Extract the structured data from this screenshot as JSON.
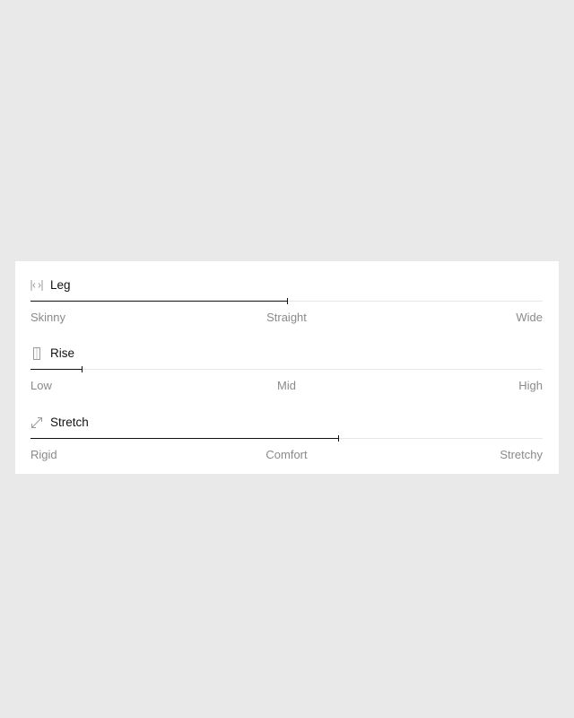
{
  "attributes": [
    {
      "title": "Leg",
      "icon": "leg-width-icon",
      "value_fraction": 0.5,
      "labels": [
        "Skinny",
        "Straight",
        "Wide"
      ]
    },
    {
      "title": "Rise",
      "icon": "rise-icon",
      "value_fraction": 0.1,
      "labels": [
        "Low",
        "Mid",
        "High"
      ]
    },
    {
      "title": "Stretch",
      "icon": "stretch-icon",
      "value_fraction": 0.6,
      "labels": [
        "Rigid",
        "Comfort",
        "Stretchy"
      ]
    }
  ],
  "colors": {
    "background": "#e9e9e9",
    "card": "#ffffff",
    "track": "#e6e6e6",
    "fill": "#111111",
    "label": "#8a8a8a",
    "icon": "#9a9a9a"
  }
}
